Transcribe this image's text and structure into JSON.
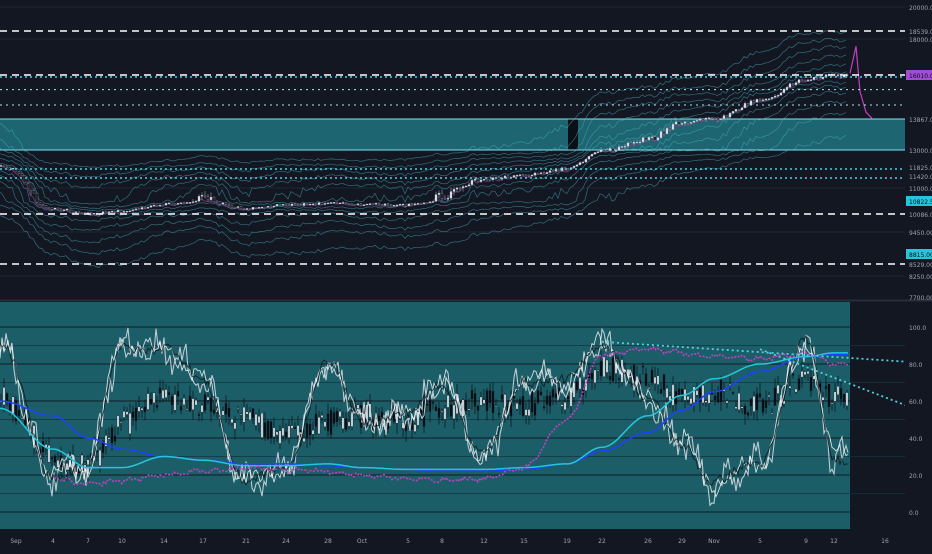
{
  "colors": {
    "background": "#131722",
    "teal_zone": "#1f6f7a",
    "grid": "#1e2533",
    "band_line": "#4fb3c4",
    "white_dashed": "#ffffff",
    "cyan_dotted": "#4dd0e1",
    "magenta": "#c040c0",
    "blue_ma": "#1e40ff",
    "cyan_ma": "#26c6da",
    "candle_dark": "#0a0f16",
    "candle_light": "#dfe6ee",
    "stoch": "#cfd6de"
  },
  "price_axis": {
    "labels": [
      "20000.00",
      "18539.00",
      "18000.00",
      "16010.00",
      "13867.00",
      "13000.00",
      "11825.00",
      "11420.00",
      "11000.00",
      "10822.51",
      "10086.00",
      "9450.00",
      "8815.00",
      "8529.00",
      "8250.00",
      "7700.00"
    ],
    "badge_labels": [
      "16010.00",
      "10822.51",
      "8815.00"
    ]
  },
  "osc_axis": {
    "labels": [
      "100.0",
      "80.0",
      "60.0",
      "40.0",
      "20.0",
      "0.0"
    ]
  },
  "time_axis": {
    "labels": [
      "Sep",
      "4",
      "7",
      "10",
      "14",
      "17",
      "21",
      "24",
      "28",
      "Oct",
      "5",
      "8",
      "12",
      "15",
      "19",
      "22",
      "26",
      "29",
      "Nov",
      "5",
      "9",
      "12",
      "16"
    ]
  },
  "chart_data": [
    {
      "type": "line",
      "panel": "price",
      "ylim": [
        7700,
        20000
      ],
      "ytick_labels": [
        "20000.00",
        "18000.00",
        "13000.00",
        "11000.00",
        "9450.00",
        "8250.00",
        "7700.00"
      ],
      "levels": {
        "white_dashed": [
          18539.0,
          16010.0,
          10086.0,
          8529.0
        ],
        "cyan_dotted": [
          16010.0,
          11825.0,
          11420.0
        ],
        "zone": [
          13000.0,
          13867.0
        ]
      },
      "x": [
        "Sep 1",
        "Sep 4",
        "Sep 7",
        "Sep 10",
        "Sep 14",
        "Sep 17",
        "Sep 21",
        "Sep 24",
        "Sep 28",
        "Oct 1",
        "Oct 5",
        "Oct 8",
        "Oct 12",
        "Oct 15",
        "Oct 19",
        "Oct 22",
        "Oct 26",
        "Oct 29",
        "Nov 1",
        "Nov 5",
        "Nov 9",
        "Nov 12"
      ],
      "series": [
        {
          "values": [
            11900,
            10400,
            10100,
            10250,
            10650,
            10850,
            10400,
            10600,
            10700,
            10650,
            10600,
            10900,
            11300,
            11450,
            11750,
            12950,
            13300,
            13800,
            13900,
            14800,
            15800,
            16000
          ]
        }
      ]
    },
    {
      "type": "line",
      "panel": "oscillator",
      "ylim": [
        0,
        100
      ],
      "ytick_labels": [
        "100.0",
        "80.0",
        "60.0",
        "40.0",
        "20.0",
        "0.0"
      ],
      "x": [
        "Sep 1",
        "Sep 4",
        "Sep 7",
        "Sep 10",
        "Sep 14",
        "Sep 17",
        "Sep 21",
        "Sep 24",
        "Sep 28",
        "Oct 1",
        "Oct 5",
        "Oct 8",
        "Oct 12",
        "Oct 15",
        "Oct 19",
        "Oct 22",
        "Oct 26",
        "Oct 29",
        "Nov 1",
        "Nov 5",
        "Nov 9",
        "Nov 12"
      ],
      "series": [
        {
          "values": [
            62,
            30,
            25,
            48,
            62,
            58,
            50,
            40,
            48,
            52,
            50,
            56,
            60,
            58,
            62,
            78,
            72,
            62,
            65,
            58,
            72,
            62
          ]
        },
        {
          "values": [
            60,
            52,
            40,
            34,
            30,
            28,
            26,
            26,
            25,
            24,
            23,
            22,
            22,
            23,
            26,
            33,
            43,
            55,
            65,
            76,
            84,
            85
          ]
        },
        {
          "values": [
            56,
            34,
            24,
            24,
            30,
            28,
            25,
            25,
            26,
            24,
            23,
            23,
            23,
            24,
            26,
            35,
            52,
            63,
            72,
            80,
            84,
            86
          ]
        },
        {
          "values": [
            null,
            18,
            15,
            17,
            20,
            22,
            24,
            23,
            22,
            20,
            18,
            17,
            18,
            24,
            50,
            85,
            88,
            86,
            84,
            83,
            86,
            80
          ]
        },
        {
          "values": [
            90,
            20,
            25,
            90,
            88,
            72,
            15,
            25,
            80,
            50,
            52,
            70,
            30,
            72,
            70,
            92,
            60,
            38,
            15,
            28,
            92,
            30
          ]
        }
      ],
      "trendlines": [
        {
          "from": [
            "Oct 22",
            92
          ],
          "to": [
            "Nov 16",
            82
          ]
        },
        {
          "from": [
            "Nov 5",
            88
          ],
          "to": [
            "Nov 16",
            62
          ]
        }
      ]
    }
  ]
}
